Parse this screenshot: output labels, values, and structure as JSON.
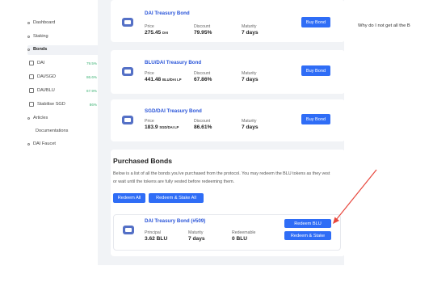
{
  "sidebar": {
    "items": [
      {
        "label": "Dashboard",
        "pct": ""
      },
      {
        "label": "Staking",
        "pct": ""
      },
      {
        "label": "Bonds",
        "pct": ""
      },
      {
        "label": "DAI",
        "pct": "79.5%"
      },
      {
        "label": "DAI/SGD",
        "pct": "86.6%"
      },
      {
        "label": "DAI/BLU",
        "pct": "67.9%"
      },
      {
        "label": "Stabilise SGD",
        "pct": "86%"
      },
      {
        "label": "Articles",
        "pct": ""
      },
      {
        "label": "Documentations",
        "pct": ""
      },
      {
        "label": "DAI Faucet",
        "pct": ""
      }
    ]
  },
  "bonds": [
    {
      "title": "DAI Treasury Bond",
      "price_label": "Price",
      "price": "275.45",
      "price_unit": "DAI",
      "discount_label": "Discount",
      "discount": "79.95%",
      "maturity_label": "Maturity",
      "maturity": "7 days",
      "button": "Buy Bond"
    },
    {
      "title": "BLU/DAI Treasury Bond",
      "price_label": "Price",
      "price": "441.48",
      "price_unit": "BLU/DAI LP",
      "discount_label": "Discount",
      "discount": "67.86%",
      "maturity_label": "Maturity",
      "maturity": "7 days",
      "button": "Buy Bond"
    },
    {
      "title": "SGD/DAI Treasury Bond",
      "price_label": "Price",
      "price": "183.9",
      "price_unit": "SGD/DAI LP",
      "discount_label": "Discount",
      "discount": "86.61%",
      "maturity_label": "Maturity",
      "maturity": "7 days",
      "button": "Buy Bond"
    }
  ],
  "faq": {
    "question": "Why do I not get all the B"
  },
  "purchased": {
    "title": "Purchased Bonds",
    "description": "Below is a list of all the bonds you've purchased from the protocol. You may redeem the BLU tokens as they vest or wait until the tokens are fully vested before redeeming them.",
    "redeem_all": "Redeem All",
    "redeem_stake_all": "Redeem & Stake All",
    "item": {
      "title": "DAI Treasury Bond (#509)",
      "principal_label": "Principal",
      "principal": "3.62 BLU",
      "maturity_label": "Maturity",
      "maturity": "7 days",
      "redeemable_label": "Redeemable",
      "redeemable": "0 BLU",
      "redeem_button": "Redeem BLU",
      "redeem_stake_button": "Redeem & Stake"
    }
  },
  "colors": {
    "accent": "#2f6df6",
    "title_blue": "#2a55d9",
    "pct_green": "#3bb273",
    "annotation": "#e8473d"
  }
}
